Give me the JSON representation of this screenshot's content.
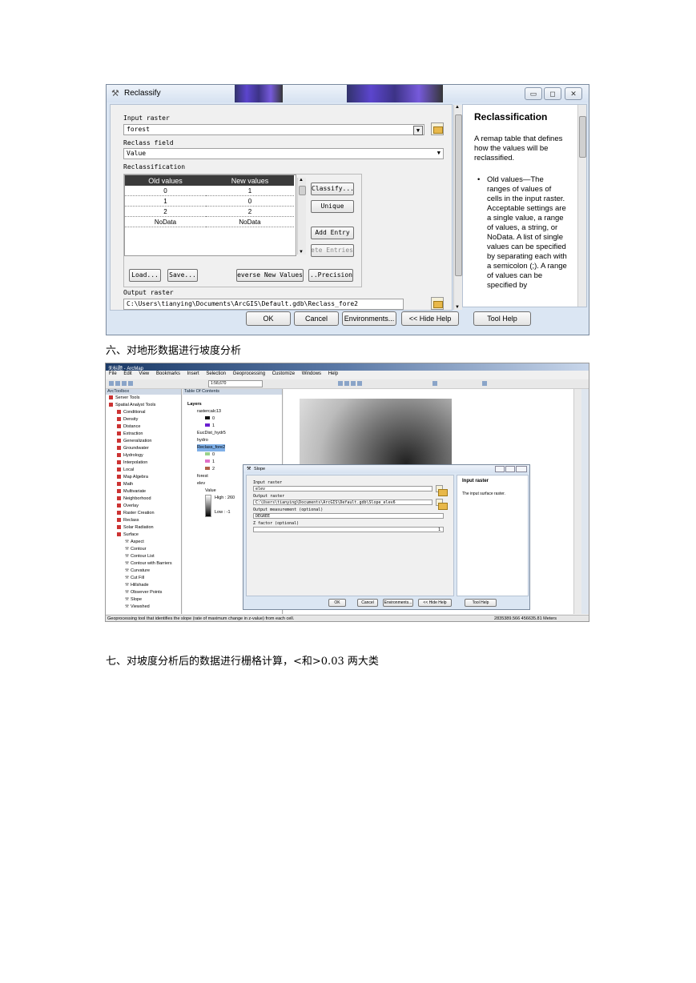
{
  "reclassify": {
    "title": "Reclassify",
    "input_raster_label": "Input raster",
    "input_raster_value": "forest",
    "reclass_field_label": "Reclass field",
    "reclass_field_value": "Value",
    "reclassification_label": "Reclassification",
    "table_headers": [
      "Old values",
      "New values"
    ],
    "rows": [
      {
        "old": "0",
        "new": "1"
      },
      {
        "old": "1",
        "new": "0"
      },
      {
        "old": "2",
        "new": "2"
      },
      {
        "old": "NoData",
        "new": "NoData"
      }
    ],
    "side_buttons": {
      "classify": "Classify...",
      "unique": "Unique",
      "add_entry": "Add Entry",
      "delete_entries": "Delete Entries"
    },
    "bottom_buttons": {
      "load": "Load...",
      "save": "Save...",
      "reverse": "Reverse New Values",
      "precision": "Precision..."
    },
    "output_raster_label": "Output raster",
    "output_raster_value": "C:\\Users\\tianying\\Documents\\ArcGIS\\Default.gdb\\Reclass_fore2",
    "footer": {
      "ok": "OK",
      "cancel": "Cancel",
      "environments": "Environments...",
      "hide_help": "<< Hide Help",
      "tool_help": "Tool Help"
    },
    "help_title": "Reclassification",
    "help_intro": "A remap table that defines how the values will be reclassified.",
    "help_bullet": "Old values—The ranges of values of cells in the input raster. Acceptable settings are a single value, a range of values, a string, or NoData. A list of single values can be specified by separating each with a semicolon (;). A range of values can be specified by"
  },
  "caption_six": "六、对地形数据进行坡度分析",
  "arcmap": {
    "title": "无标题 - ArcMap",
    "menu": [
      "File",
      "Edit",
      "View",
      "Bookmarks",
      "Insert",
      "Selection",
      "Geoprocessing",
      "Customize",
      "Windows",
      "Help"
    ],
    "scale": "1:58,670",
    "toolbox_title": "ArcToolbox",
    "toolbox_items": [
      "Server Tools",
      "Spatial Analyst Tools",
      "Conditional",
      "Density",
      "Distance",
      "Extraction",
      "Generalization",
      "Groundwater",
      "Hydrology",
      "Interpolation",
      "Local",
      "Map Algebra",
      "Math",
      "Multivariate",
      "Neighborhood",
      "Overlay",
      "Raster Creation",
      "Reclass",
      "Solar Radiation",
      "Surface"
    ],
    "surface_tools": [
      "Aspect",
      "Contour",
      "Contour List",
      "Contour with Barriers",
      "Curvature",
      "Cut Fill",
      "Hillshade",
      "Observer Points",
      "Slope",
      "Viewshed"
    ],
    "toc_title": "Table Of Contents",
    "toc_layers": [
      "Layers",
      "rastercalc13",
      "0",
      "1",
      "EucDist_hydr5",
      "hydro",
      "Reclass_fore2",
      "0",
      "1",
      "2",
      "forest",
      "elev",
      "Value",
      "High : 260",
      "Low : -1"
    ],
    "status_text": "Geoprocessing tool that identifies the slope (rate of maximum change in z-value) from each cell.",
    "coords": "2835389.566  456635.81 Meters",
    "slope_dialog": {
      "title": "Slope",
      "input_label": "Input raster",
      "input_value": "elev",
      "output_label": "Output raster",
      "output_value": "C:\\Users\\tianying\\Documents\\ArcGIS\\Default.gdb\\Slope_elev6",
      "measurement_label": "Output measurement (optional)",
      "measurement_value": "DEGREE",
      "zfactor_label": "Z factor (optional)",
      "zfactor_value": "1",
      "help_title": "Input raster",
      "help_text": "The input surface raster.",
      "buttons": [
        "OK",
        "Cancel",
        "Environments...",
        "<< Hide Help",
        "Tool Help"
      ]
    }
  },
  "caption_seven": "七、对坡度分析后的数据进行栅格计算，<和>0.03 两大类"
}
